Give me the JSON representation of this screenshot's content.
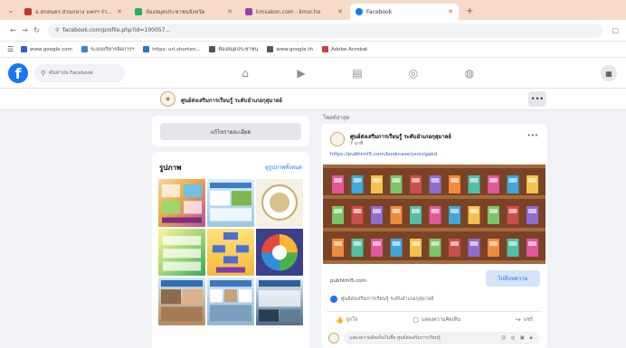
{
  "browser": {
    "tabs": [
      {
        "label": "อ.สกลนคร ส่วนกลาง แพรฯ ร่วมกิจกรรม",
        "favicon_color": "#c0392b",
        "active": false
      },
      {
        "label": "ห้องสมุดประชาชนจังหวัด",
        "favicon_color": "#27ae60",
        "active": false
      },
      {
        "label": "kmsakon.com - kmsr.ho",
        "favicon_color": "#8e44ad",
        "active": false
      },
      {
        "label": "Facebook",
        "favicon_color": "#1877f2",
        "active": true
      }
    ],
    "url": "facebook.com/profile.php?id=100057...",
    "bookmarks": [
      {
        "label": "www.google.com",
        "color": "#3b5fc9"
      },
      {
        "label": "ระบบบริหารจัดการฯ",
        "color": "#3b82c4"
      },
      {
        "label": "https: url.shorten...",
        "color": "#2f6fd1"
      },
      {
        "label": "ห้องสมุดประชาชน",
        "color": "#555555"
      },
      {
        "label": "www.google.th",
        "color": "#555555"
      },
      {
        "label": "Adobe Acrobat",
        "color": "#d03b3b"
      }
    ]
  },
  "facebook": {
    "search_placeholder": "ค้นหาบน Facebook",
    "page_name": "ศูนย์ส่งเสริมการเรียนรู้ ระดับอำเภอกุสุมาลย์",
    "edit_details_label": "แก้ไขรายละเอียด",
    "photos": {
      "title": "รูปภาพ",
      "see_all": "ดูรูปภาพทั้งหมด"
    },
    "post_section_label": "โพสต์ล่าสุด",
    "post": {
      "author": "ศูนย์ส่งเสริมการเรียนรู้ ระดับอำเภอกุสุมาลย์",
      "time": "7 นาที",
      "link": "https://pubhtml5.com/bookcase/ysnn/gakd",
      "domain": "pubhtml5.com",
      "cta": "ไปที่บทความ",
      "reaction_text": "ศูนย์ส่งเสริมการเรียนรู้ ระดับอำเภอกุสุมาลย์",
      "like": "ถูกใจ",
      "comment": "แสดงความคิดเห็น",
      "share": "แชร์",
      "comment_placeholder": "แสดงความคิดเห็นในชื่อ ศูนย์ส่งเสริมการเรียนรู้"
    }
  }
}
